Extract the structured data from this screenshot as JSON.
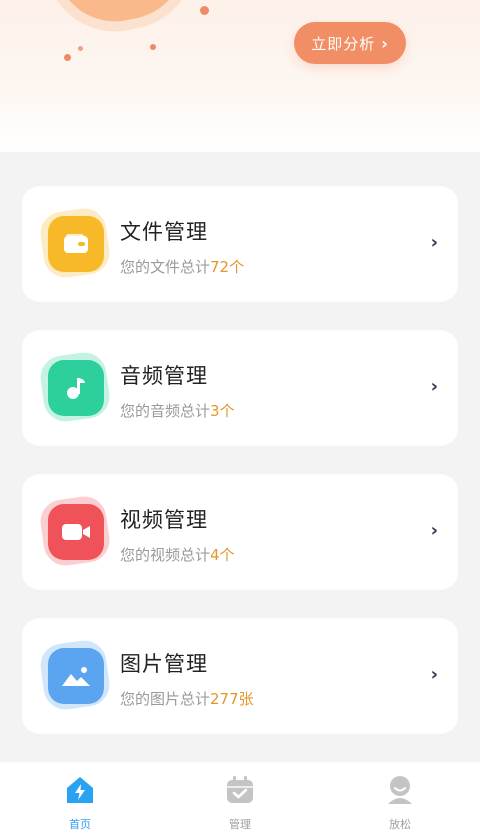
{
  "header": {
    "analyze_button_label": "立即分析",
    "chevron": "›"
  },
  "cards": [
    {
      "title": "文件管理",
      "sub_prefix": "您的文件总计",
      "count": "72个",
      "icon": "wallet-icon",
      "color": "#f7b928"
    },
    {
      "title": "音频管理",
      "sub_prefix": "您的音频总计",
      "count": "3个",
      "icon": "music-note-icon",
      "color": "#2dcf9c"
    },
    {
      "title": "视频管理",
      "sub_prefix": "您的视频总计",
      "count": "4个",
      "icon": "video-camera-icon",
      "color": "#f0525a"
    },
    {
      "title": "图片管理",
      "sub_prefix": "您的图片总计",
      "count": "277张",
      "icon": "image-icon",
      "color": "#5ba5f0"
    }
  ],
  "tabs": [
    {
      "label": "首页",
      "icon": "home-lightning-icon",
      "active": true
    },
    {
      "label": "管理",
      "icon": "calendar-check-icon",
      "active": false
    },
    {
      "label": "放松",
      "icon": "person-icon",
      "active": false
    }
  ],
  "colors": {
    "accent": "#f28e66",
    "count_highlight": "#e5962c",
    "tab_active": "#2aa2f2",
    "tab_inactive": "#c4c4c4"
  }
}
